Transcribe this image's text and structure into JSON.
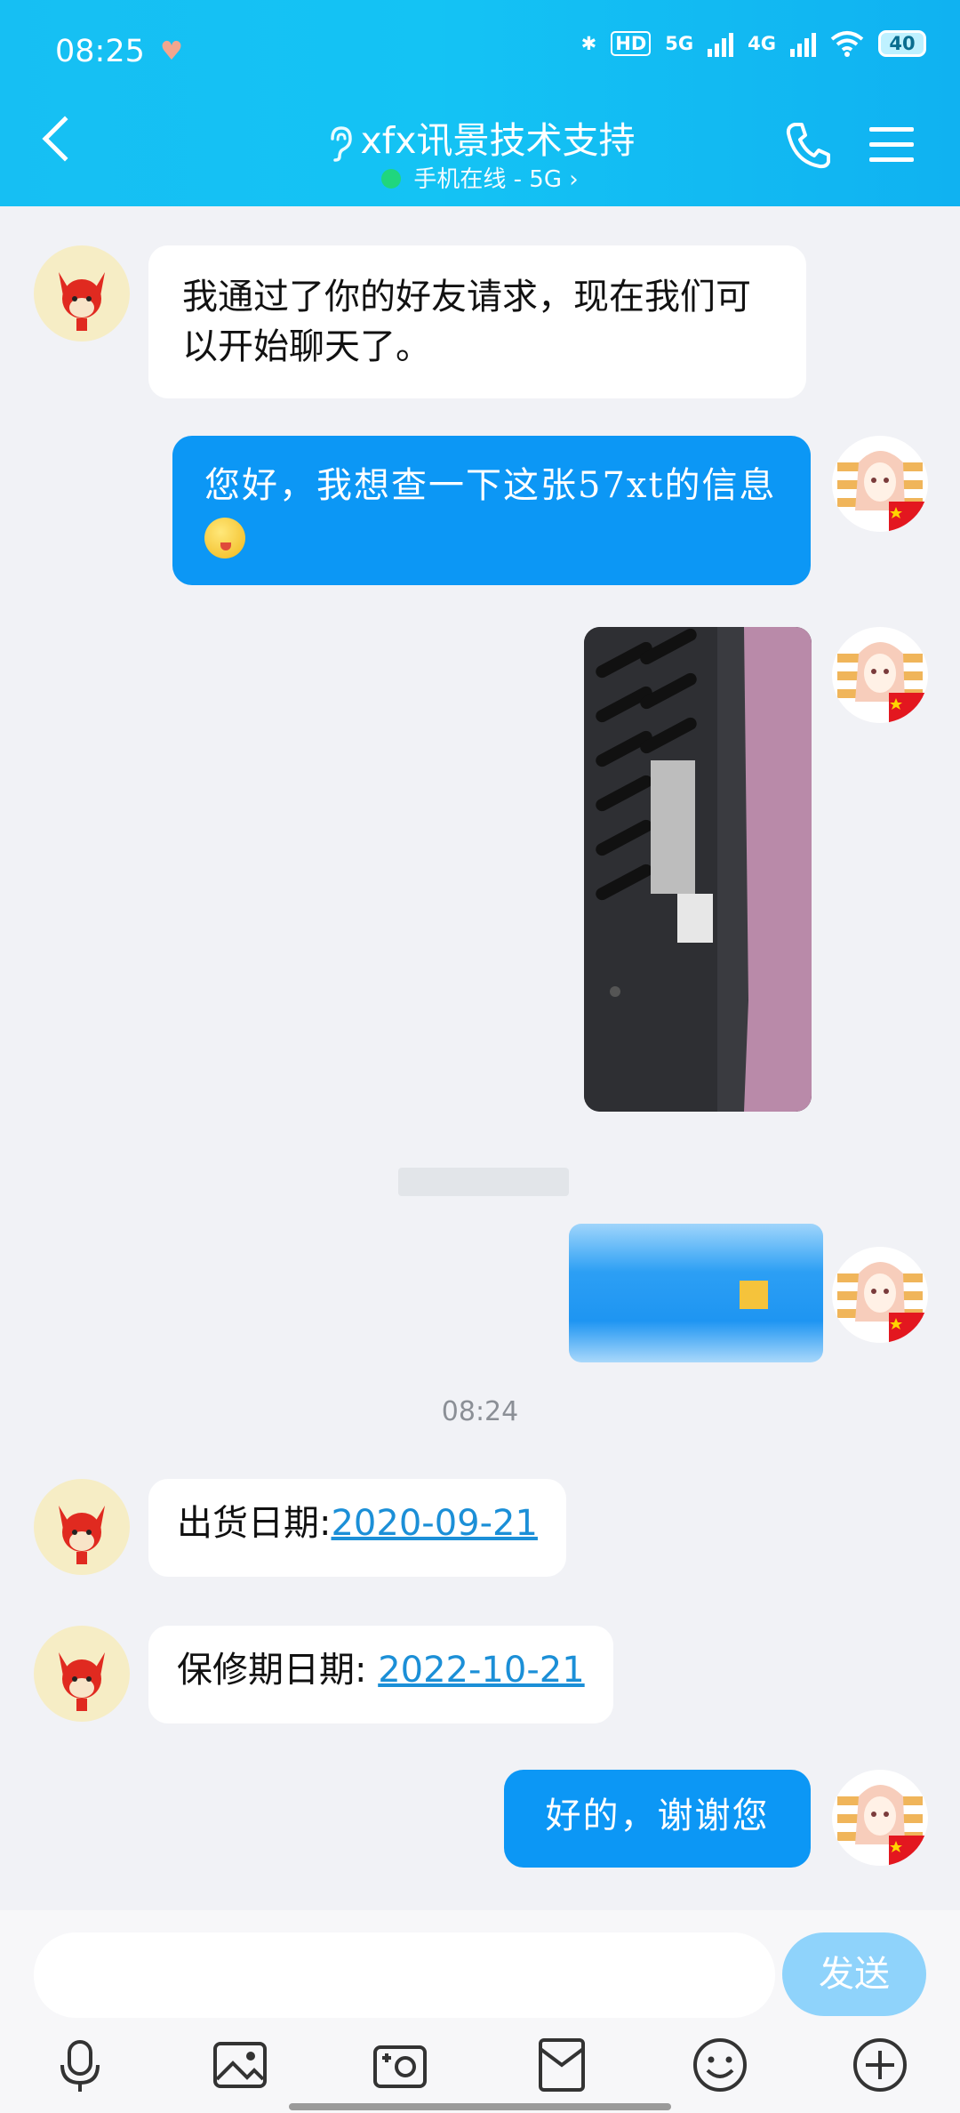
{
  "status_bar": {
    "time": "08:25",
    "battery": "40",
    "network_1": "5G",
    "network_2": "4G"
  },
  "header": {
    "title": "xfx讯景技术支持",
    "subtitle": "手机在线 - 5G ›"
  },
  "messages": {
    "m1": "我通过了你的好友请求，现在我们可以开始聊天了。",
    "m2": "您好，我想查一下这张57xt的信息",
    "timestamp": "08:24",
    "m3_label": "出货日期:",
    "m3_date": "2020-09-21",
    "m4_label": "保修期日期: ",
    "m4_date": "2022-10-21",
    "m5": "好的，谢谢您"
  },
  "composer": {
    "send_label": "发送",
    "placeholder": ""
  },
  "colors": {
    "header_accent": "#16bff3",
    "outgoing_bubble": "#0c97f5",
    "link": "#1b8fd7",
    "send_button": "#8fd3fb"
  },
  "icons": {
    "toolbar": [
      "microphone-icon",
      "image-icon",
      "camera-icon",
      "red-packet-icon",
      "emoji-icon",
      "plus-icon"
    ]
  }
}
